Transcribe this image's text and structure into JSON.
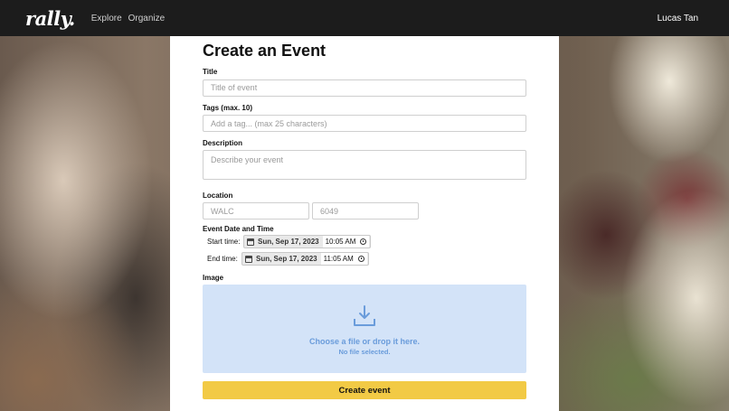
{
  "nav": {
    "logo": "rally.",
    "links": [
      "Explore",
      "Organize"
    ],
    "user": "Lucas Tan"
  },
  "form": {
    "title": "Create an Event",
    "fields": {
      "title_label": "Title",
      "title_placeholder": "Title of event",
      "tags_label": "Tags (max. 10)",
      "tags_placeholder": "Add a tag... (max 25 characters)",
      "description_label": "Description",
      "description_placeholder": "Describe your event",
      "location_label": "Location",
      "location_building_value": "WALC",
      "location_room_value": "6049",
      "datetime_label": "Event Date and Time",
      "start_label": "Start time:",
      "start_date": "Sun, Sep 17, 2023",
      "start_time": "10:05 AM",
      "end_label": "End time:",
      "end_date": "Sun, Sep 17, 2023",
      "end_time": "11:05 AM",
      "image_label": "Image",
      "drop_main": "Choose a file or drop it here.",
      "drop_sub": "No file selected."
    },
    "submit_label": "Create event"
  },
  "colors": {
    "nav_bg": "#1c1c1c",
    "accent_button": "#f2ca45",
    "dropzone_bg": "#d3e3f8",
    "dropzone_text": "#6a9cdb"
  },
  "icons": {
    "calendar": "calendar-icon",
    "clock": "clock-icon",
    "download": "download-icon"
  }
}
